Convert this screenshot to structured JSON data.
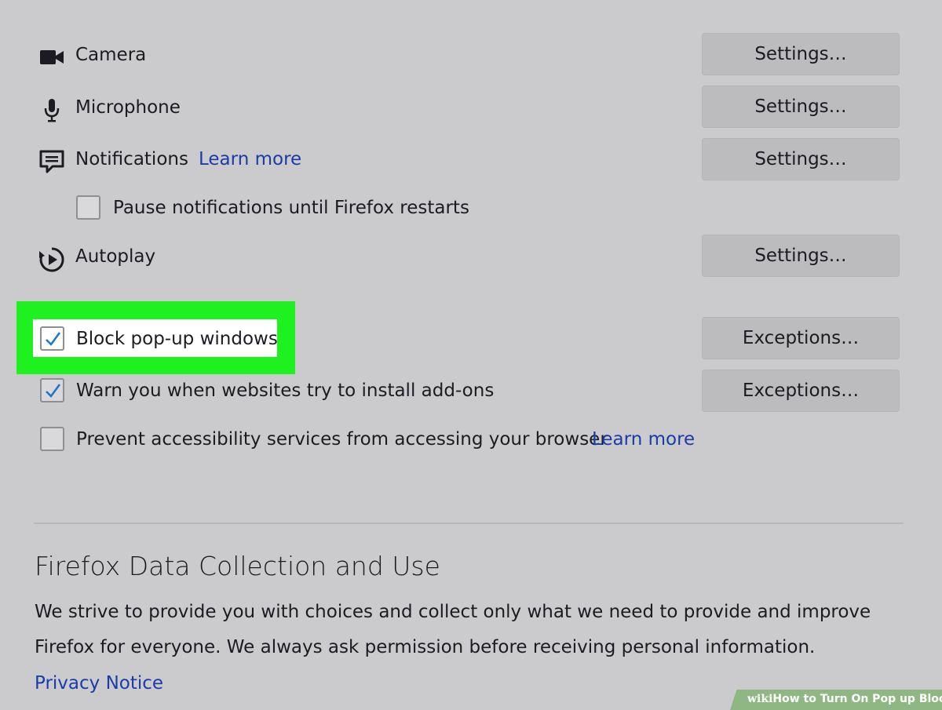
{
  "permissions": {
    "camera": {
      "label": "Camera",
      "button": "Settings…",
      "icon": "camera-icon"
    },
    "microphone": {
      "label": "Microphone",
      "button": "Settings…",
      "icon": "microphone-icon"
    },
    "notifications": {
      "label": "Notifications",
      "learn_more": "Learn more",
      "button": "Settings…",
      "icon": "speech-bubble-icon"
    },
    "pause_notifications": {
      "label": "Pause notifications until Firefox restarts",
      "checked": false
    },
    "autoplay": {
      "label": "Autoplay",
      "button": "Settings…",
      "icon": "play-circle-icon"
    },
    "block_popups": {
      "label": "Block pop-up windows",
      "checked": true,
      "button": "Exceptions…"
    },
    "warn_addons": {
      "label": "Warn you when websites try to install add-ons",
      "checked": true,
      "button": "Exceptions…"
    },
    "prevent_accessibility": {
      "label": "Prevent accessibility services from accessing your browser",
      "learn_more": "Learn more",
      "checked": false
    }
  },
  "data_collection": {
    "title": "Firefox Data Collection and Use",
    "line1": "We strive to provide you with choices and collect only what we need to provide and improve",
    "line2": "Firefox for everyone. We always ask permission before receiving personal information.",
    "privacy_link": "Privacy Notice"
  },
  "watermark": {
    "brand": "wiki",
    "text": "How to Turn On Pop up Blocker"
  },
  "colors": {
    "background": "#cbcbcd",
    "link": "#1a3ca8",
    "highlight": "#1ff01f",
    "check": "#1a76c8"
  }
}
